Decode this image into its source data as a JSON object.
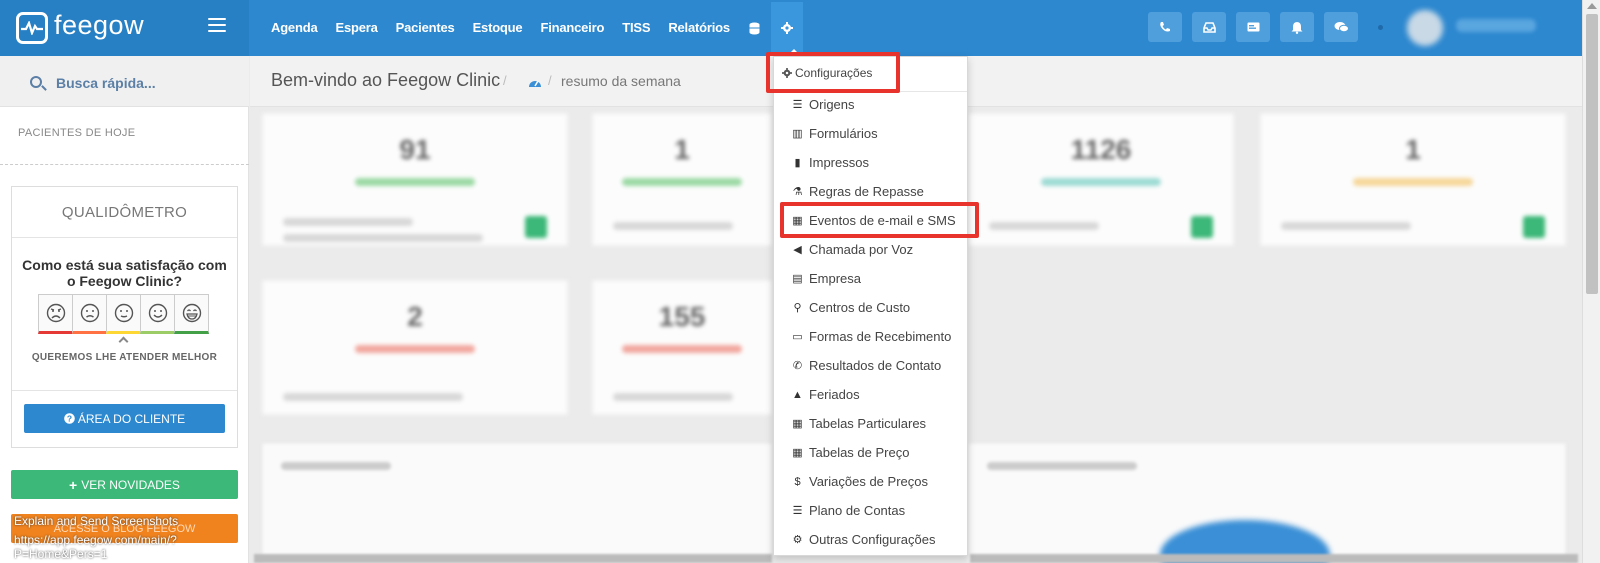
{
  "app": {
    "logo_text": "feegow"
  },
  "nav": {
    "items": [
      "Agenda",
      "Espera",
      "Pacientes",
      "Estoque",
      "Financeiro",
      "TISS",
      "Relatórios"
    ],
    "icons": [
      "database-icon",
      "gear-icon"
    ]
  },
  "topbar": {
    "icons": [
      "phone-icon",
      "inbox-icon",
      "card-icon",
      "bell-icon",
      "chat-icon"
    ]
  },
  "sidebar": {
    "search_placeholder": "Busca rápida...",
    "patients_today": "PACIENTES DE HOJE",
    "quali": {
      "title": "QUALIDÔMETRO",
      "question": "Como está sua satisfação com o Feegow Clinic?",
      "footer": "QUEREMOS LHE ATENDER MELHOR",
      "face_colors": [
        "#e53935",
        "#ff7043",
        "#fdd835",
        "#9ccc65",
        "#43a047"
      ]
    },
    "client_area_label": "ÁREA DO CLIENTE",
    "news_label": "VER NOVIDADES",
    "blog_label": "ACESSE O BLOG FEEGOW"
  },
  "overlay": {
    "explain": "Explain and Send Screenshots",
    "url": "https://app.feegow.com/main/?P=Home&Pers=1"
  },
  "main": {
    "welcome": "Bem-vindo ao Feegow Clinic",
    "breadcrumb": "resumo da semana"
  },
  "dropdown": {
    "header": "Configurações",
    "items": [
      {
        "label": "Origens",
        "icon": "list-icon",
        "glyph": "☰"
      },
      {
        "label": "Formulários",
        "icon": "bar-chart-icon",
        "glyph": "▥"
      },
      {
        "label": "Impressos",
        "icon": "file-icon",
        "glyph": "▮"
      },
      {
        "label": "Regras de Repasse",
        "icon": "sitemap-icon",
        "glyph": "⚗"
      },
      {
        "label": "Eventos de e-mail e SMS",
        "icon": "calendar-icon",
        "glyph": "▦"
      },
      {
        "label": "Chamada por Voz",
        "icon": "volume-icon",
        "glyph": "◀"
      },
      {
        "label": "Empresa",
        "icon": "building-icon",
        "glyph": "▤"
      },
      {
        "label": "Centros de Custo",
        "icon": "org-chart-icon",
        "glyph": "⚲"
      },
      {
        "label": "Formas de Recebimento",
        "icon": "credit-card-icon",
        "glyph": "▭"
      },
      {
        "label": "Resultados de Contato",
        "icon": "phone-icon",
        "glyph": "✆"
      },
      {
        "label": "Feriados",
        "icon": "road-icon",
        "glyph": "▲"
      },
      {
        "label": "Tabelas Particulares",
        "icon": "table-icon",
        "glyph": "▦"
      },
      {
        "label": "Tabelas de Preço",
        "icon": "table-icon",
        "glyph": "▦"
      },
      {
        "label": "Variações de Preços",
        "icon": "dollar-icon",
        "glyph": "$"
      },
      {
        "label": "Plano de Contas",
        "icon": "list-alt-icon",
        "glyph": "☰"
      },
      {
        "label": "Outras Configurações",
        "icon": "cogs-icon",
        "glyph": "⚙"
      }
    ]
  },
  "colors": {
    "primary": "#2d88cf",
    "success": "#3cb878",
    "warning": "#f0831e",
    "highlight": "#e8322c"
  }
}
